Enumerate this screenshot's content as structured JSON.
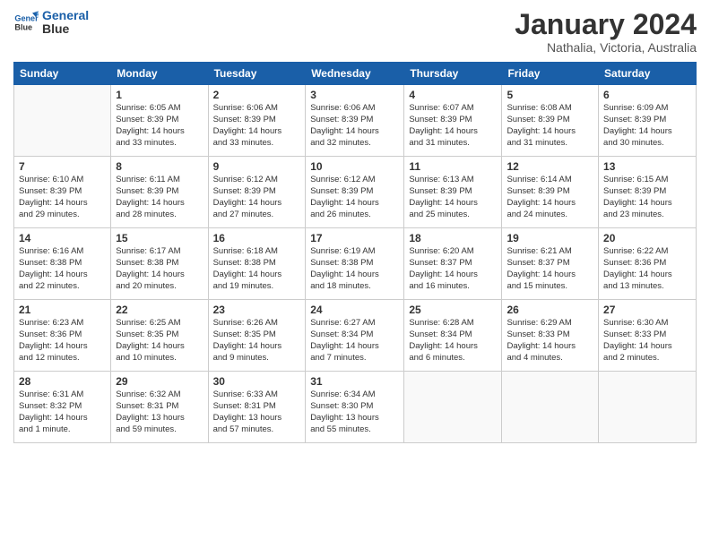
{
  "logo": {
    "line1": "General",
    "line2": "Blue"
  },
  "title": "January 2024",
  "location": "Nathalia, Victoria, Australia",
  "headers": [
    "Sunday",
    "Monday",
    "Tuesday",
    "Wednesday",
    "Thursday",
    "Friday",
    "Saturday"
  ],
  "weeks": [
    [
      {
        "day": "",
        "info": ""
      },
      {
        "day": "1",
        "info": "Sunrise: 6:05 AM\nSunset: 8:39 PM\nDaylight: 14 hours\nand 33 minutes."
      },
      {
        "day": "2",
        "info": "Sunrise: 6:06 AM\nSunset: 8:39 PM\nDaylight: 14 hours\nand 33 minutes."
      },
      {
        "day": "3",
        "info": "Sunrise: 6:06 AM\nSunset: 8:39 PM\nDaylight: 14 hours\nand 32 minutes."
      },
      {
        "day": "4",
        "info": "Sunrise: 6:07 AM\nSunset: 8:39 PM\nDaylight: 14 hours\nand 31 minutes."
      },
      {
        "day": "5",
        "info": "Sunrise: 6:08 AM\nSunset: 8:39 PM\nDaylight: 14 hours\nand 31 minutes."
      },
      {
        "day": "6",
        "info": "Sunrise: 6:09 AM\nSunset: 8:39 PM\nDaylight: 14 hours\nand 30 minutes."
      }
    ],
    [
      {
        "day": "7",
        "info": "Sunrise: 6:10 AM\nSunset: 8:39 PM\nDaylight: 14 hours\nand 29 minutes."
      },
      {
        "day": "8",
        "info": "Sunrise: 6:11 AM\nSunset: 8:39 PM\nDaylight: 14 hours\nand 28 minutes."
      },
      {
        "day": "9",
        "info": "Sunrise: 6:12 AM\nSunset: 8:39 PM\nDaylight: 14 hours\nand 27 minutes."
      },
      {
        "day": "10",
        "info": "Sunrise: 6:12 AM\nSunset: 8:39 PM\nDaylight: 14 hours\nand 26 minutes."
      },
      {
        "day": "11",
        "info": "Sunrise: 6:13 AM\nSunset: 8:39 PM\nDaylight: 14 hours\nand 25 minutes."
      },
      {
        "day": "12",
        "info": "Sunrise: 6:14 AM\nSunset: 8:39 PM\nDaylight: 14 hours\nand 24 minutes."
      },
      {
        "day": "13",
        "info": "Sunrise: 6:15 AM\nSunset: 8:39 PM\nDaylight: 14 hours\nand 23 minutes."
      }
    ],
    [
      {
        "day": "14",
        "info": "Sunrise: 6:16 AM\nSunset: 8:38 PM\nDaylight: 14 hours\nand 22 minutes."
      },
      {
        "day": "15",
        "info": "Sunrise: 6:17 AM\nSunset: 8:38 PM\nDaylight: 14 hours\nand 20 minutes."
      },
      {
        "day": "16",
        "info": "Sunrise: 6:18 AM\nSunset: 8:38 PM\nDaylight: 14 hours\nand 19 minutes."
      },
      {
        "day": "17",
        "info": "Sunrise: 6:19 AM\nSunset: 8:38 PM\nDaylight: 14 hours\nand 18 minutes."
      },
      {
        "day": "18",
        "info": "Sunrise: 6:20 AM\nSunset: 8:37 PM\nDaylight: 14 hours\nand 16 minutes."
      },
      {
        "day": "19",
        "info": "Sunrise: 6:21 AM\nSunset: 8:37 PM\nDaylight: 14 hours\nand 15 minutes."
      },
      {
        "day": "20",
        "info": "Sunrise: 6:22 AM\nSunset: 8:36 PM\nDaylight: 14 hours\nand 13 minutes."
      }
    ],
    [
      {
        "day": "21",
        "info": "Sunrise: 6:23 AM\nSunset: 8:36 PM\nDaylight: 14 hours\nand 12 minutes."
      },
      {
        "day": "22",
        "info": "Sunrise: 6:25 AM\nSunset: 8:35 PM\nDaylight: 14 hours\nand 10 minutes."
      },
      {
        "day": "23",
        "info": "Sunrise: 6:26 AM\nSunset: 8:35 PM\nDaylight: 14 hours\nand 9 minutes."
      },
      {
        "day": "24",
        "info": "Sunrise: 6:27 AM\nSunset: 8:34 PM\nDaylight: 14 hours\nand 7 minutes."
      },
      {
        "day": "25",
        "info": "Sunrise: 6:28 AM\nSunset: 8:34 PM\nDaylight: 14 hours\nand 6 minutes."
      },
      {
        "day": "26",
        "info": "Sunrise: 6:29 AM\nSunset: 8:33 PM\nDaylight: 14 hours\nand 4 minutes."
      },
      {
        "day": "27",
        "info": "Sunrise: 6:30 AM\nSunset: 8:33 PM\nDaylight: 14 hours\nand 2 minutes."
      }
    ],
    [
      {
        "day": "28",
        "info": "Sunrise: 6:31 AM\nSunset: 8:32 PM\nDaylight: 14 hours\nand 1 minute."
      },
      {
        "day": "29",
        "info": "Sunrise: 6:32 AM\nSunset: 8:31 PM\nDaylight: 13 hours\nand 59 minutes."
      },
      {
        "day": "30",
        "info": "Sunrise: 6:33 AM\nSunset: 8:31 PM\nDaylight: 13 hours\nand 57 minutes."
      },
      {
        "day": "31",
        "info": "Sunrise: 6:34 AM\nSunset: 8:30 PM\nDaylight: 13 hours\nand 55 minutes."
      },
      {
        "day": "",
        "info": ""
      },
      {
        "day": "",
        "info": ""
      },
      {
        "day": "",
        "info": ""
      }
    ]
  ]
}
